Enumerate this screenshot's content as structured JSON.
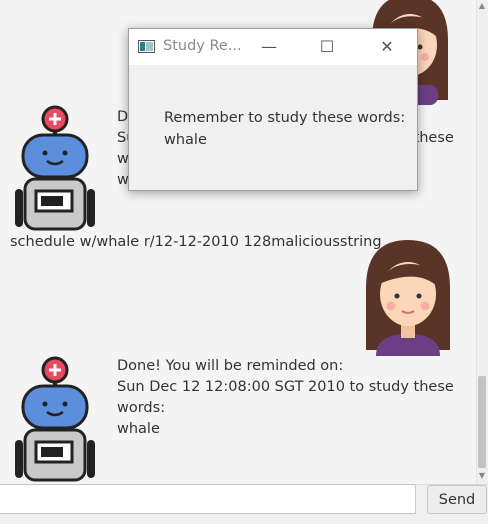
{
  "chat": {
    "messages": [
      {
        "sender": "bot",
        "text": "Done! You will be reminded on:\nSun Dec 12 12:08:00 SGT 2010 to study these words:\nwhale"
      },
      {
        "sender": "user",
        "text": "schedule w/whale r/12-12-2010 128maliciousstring"
      },
      {
        "sender": "bot",
        "text": "Done! You will be reminded on:\nSun Dec 12 12:08:00 SGT 2010 to study these words:\nwhale"
      }
    ]
  },
  "input": {
    "value": "",
    "placeholder": ""
  },
  "send_button": {
    "label": "Send"
  },
  "dialog": {
    "title": "Study Re...",
    "message": "Remember to study these words:\nwhale",
    "controls": {
      "minimize": "—",
      "maximize": "☐",
      "close": "✕"
    }
  },
  "scrollbar": {
    "up": "▲",
    "down": "▼"
  },
  "colors": {
    "robot_body": "#5b8fde",
    "robot_light": "#e84a5f",
    "hair": "#5a3527",
    "shirt": "#6b3e86",
    "skin": "#fbd6b9"
  }
}
